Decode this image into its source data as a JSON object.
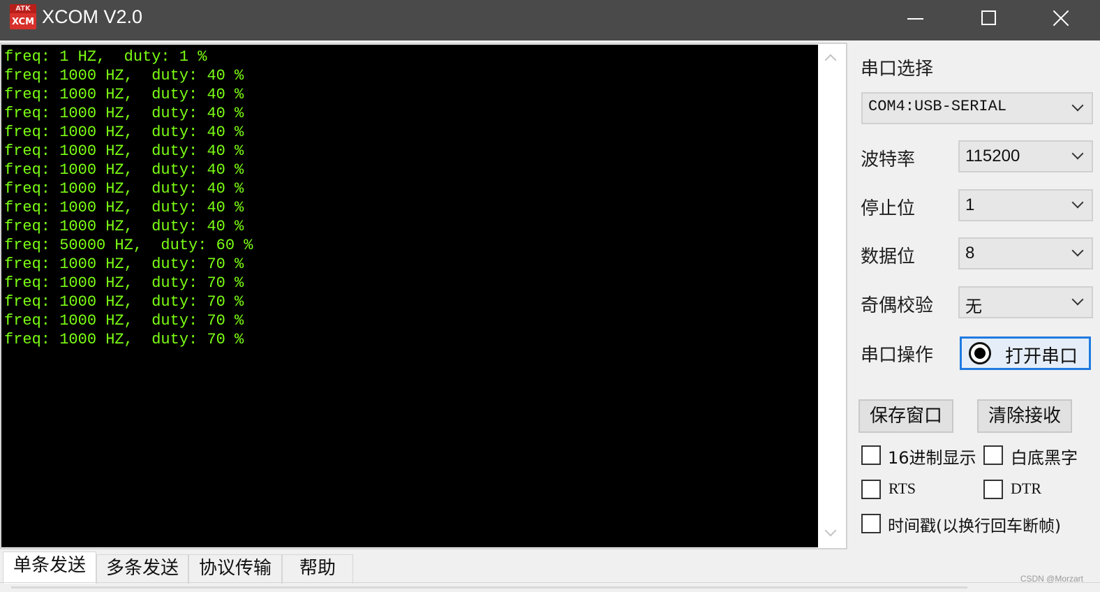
{
  "window": {
    "title": "XCOM V2.0",
    "logo_top": "ATK",
    "logo_bottom": "XCM"
  },
  "receive_lines": [
    "freq: 1 HZ,  duty: 1 %",
    "freq: 1000 HZ,  duty: 40 %",
    "freq: 1000 HZ,  duty: 40 %",
    "freq: 1000 HZ,  duty: 40 %",
    "freq: 1000 HZ,  duty: 40 %",
    "freq: 1000 HZ,  duty: 40 %",
    "freq: 1000 HZ,  duty: 40 %",
    "freq: 1000 HZ,  duty: 40 %",
    "freq: 1000 HZ,  duty: 40 %",
    "freq: 1000 HZ,  duty: 40 %",
    "freq: 50000 HZ,  duty: 60 %",
    "freq: 1000 HZ,  duty: 70 %",
    "freq: 1000 HZ,  duty: 70 %",
    "freq: 1000 HZ,  duty: 70 %",
    "freq: 1000 HZ,  duty: 70 %",
    "freq: 1000 HZ,  duty: 70 %"
  ],
  "serial": {
    "port_label": "串口选择",
    "port_value": "COM4:USB-SERIAL",
    "baud_label": "波特率",
    "baud_value": "115200",
    "stopbits_label": "停止位",
    "stopbits_value": "1",
    "databits_label": "数据位",
    "databits_value": "8",
    "parity_label": "奇偶校验",
    "parity_value": "无",
    "op_label": "串口操作",
    "open_button": "打开串口"
  },
  "actions": {
    "save_window": "保存窗口",
    "clear_receive": "清除接收"
  },
  "options": {
    "hex_display": "16进制显示",
    "white_bg": "白底黑字",
    "rts": "RTS",
    "dtr": "DTR",
    "timestamp": "时间戳(以换行回车断帧)"
  },
  "tabs": [
    "单条发送",
    "多条发送",
    "协议传输",
    "帮助"
  ],
  "watermark": "CSDN @Morzart",
  "colors": {
    "terminal_text": "#7cff14",
    "terminal_bg": "#000000",
    "titlebar": "#4a4a4a",
    "focus_border": "#1f7ae0"
  }
}
